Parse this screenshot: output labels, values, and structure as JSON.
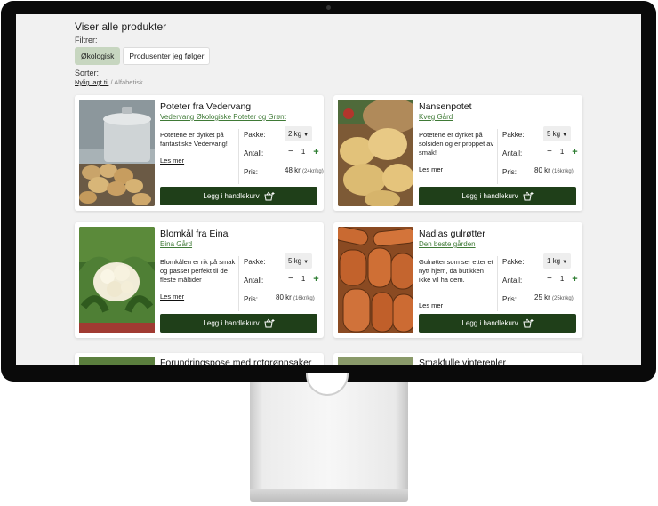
{
  "page": {
    "title": "Viser alle produkter",
    "filter_label": "Filtrer:",
    "filters": [
      {
        "label": "Økologisk",
        "active": true
      },
      {
        "label": "Produsenter jeg følger",
        "active": false
      }
    ],
    "sort_label": "Sorter:",
    "sort_options": {
      "active": "Nylig lagt til",
      "separator": " / ",
      "other": "Alfabetisk"
    }
  },
  "labels": {
    "pack": "Pakke:",
    "qty": "Antall:",
    "price": "Pris:",
    "read_more": "Les mer",
    "add_to_cart": "Legg i handlekurv",
    "minus": "−",
    "plus": "+"
  },
  "products": [
    {
      "title": "Poteter fra Vedervang",
      "producer": "Vedervang Økologiske Poteter og Grønt",
      "description": "Potetene er dyrket på fantastiske Vedervang!",
      "pack": "2 kg",
      "qty": "1",
      "price": "48 kr",
      "unit_price": "(24kr/kg)",
      "image": "potatoes-in-pot-photo"
    },
    {
      "title": "Nansenpotet",
      "producer": "Kveg Gård",
      "description": "Potetene er dyrket på solsiden og er proppet av smak!",
      "pack": "5 kg",
      "qty": "1",
      "price": "80 kr",
      "unit_price": "(16kr/kg)",
      "image": "potatoes-sack-photo"
    },
    {
      "title": "Blomkål fra Eina",
      "producer": "Eina Gård",
      "description": "Blomkålen er rik på smak og passer perfekt til de fleste måltider",
      "pack": "5 kg",
      "qty": "1",
      "price": "80 kr",
      "unit_price": "(16kr/kg)",
      "image": "cauliflower-photo"
    },
    {
      "title": "Nadias gulrøtter",
      "producer": "Den beste gården",
      "description": "Gulrøtter som ser etter et nytt hjem, da butikken ikke vil ha dem.",
      "pack": "1 kg",
      "qty": "1",
      "price": "25 kr",
      "unit_price": "(25kr/kg)",
      "image": "carrots-photo"
    }
  ],
  "partial_products": [
    {
      "title": "Forundringspose med rotgrønnsaker"
    },
    {
      "title": "Smakfulle vinterepler"
    }
  ],
  "colors": {
    "brand_green": "#1f3f19",
    "link_green": "#3f7a36",
    "active_chip": "#c7d6c0",
    "page_bg": "#f1f1f1"
  }
}
